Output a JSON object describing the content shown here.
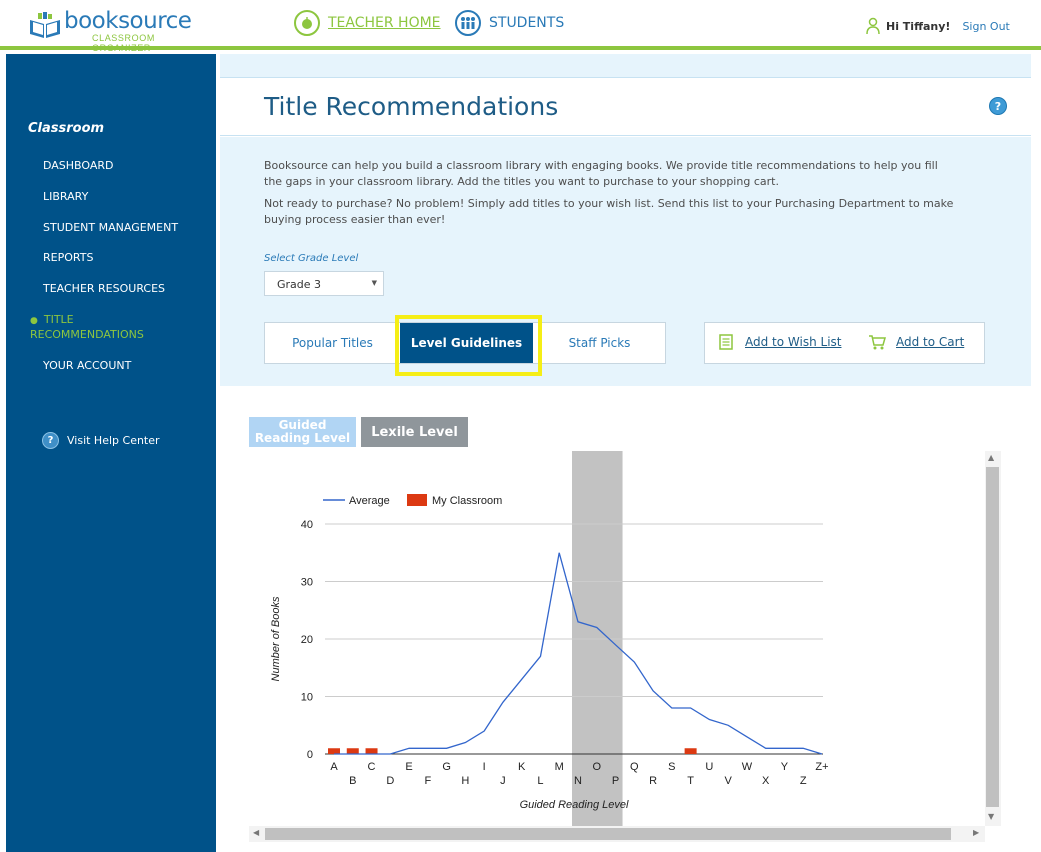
{
  "header": {
    "logo_name": "booksource",
    "logo_sub": "CLASSROOM ORGANIZER",
    "teacher_home": "TEACHER HOME",
    "students": "STUDENTS",
    "greeting": "Hi Tiffany!",
    "sign_out": "Sign Out"
  },
  "sidebar": {
    "title": "Classroom",
    "items": [
      {
        "label": "DASHBOARD"
      },
      {
        "label": "LIBRARY"
      },
      {
        "label": "STUDENT MANAGEMENT"
      },
      {
        "label": "REPORTS"
      },
      {
        "label": "TEACHER RESOURCES"
      },
      {
        "label": "TITLE"
      },
      {
        "label": "RECOMMENDATIONS"
      },
      {
        "label": "YOUR ACCOUNT"
      }
    ],
    "help": "Visit Help Center"
  },
  "main": {
    "title": "Title Recommendations",
    "help_glyph": "?",
    "intro1": "Booksource can help you build a classroom library with engaging books. We provide title recommendations to help you fill the gaps in your classroom library. Add the titles you want to purchase to your shopping cart.",
    "intro2": "Not ready to purchase? No problem! Simply add titles to your wish list. Send this list to your Purchasing Department to make buying process easier than ever!",
    "grade_label": "Select Grade Level",
    "grade_value": "Grade 3",
    "tabs": [
      {
        "label": "Popular Titles"
      },
      {
        "label": "Level Guidelines"
      },
      {
        "label": "Staff Picks"
      }
    ],
    "wish_list": "Add to Wish List",
    "cart": "Add to Cart",
    "toggle_grl": "Guided Reading Level",
    "toggle_lexile": "Lexile Level"
  },
  "colors": {
    "accent_green": "#8dc63f",
    "brand_blue": "#005289",
    "line_blue": "#3366cc",
    "bar_red": "#dc3912",
    "highlight_yellow": "#f5ee16"
  },
  "chart_data": {
    "type": "line",
    "xlabel": "Guided Reading Level",
    "ylabel": "Number of Books",
    "ylim": [
      0,
      40
    ],
    "yticks": [
      0,
      10,
      20,
      30,
      40
    ],
    "grid": true,
    "legend_position": "top-left",
    "categories": [
      "A",
      "B",
      "C",
      "D",
      "E",
      "F",
      "G",
      "H",
      "I",
      "J",
      "K",
      "L",
      "M",
      "N",
      "O",
      "P",
      "Q",
      "R",
      "S",
      "T",
      "U",
      "V",
      "W",
      "X",
      "Y",
      "Z",
      "Z+"
    ],
    "highlight_range": [
      "N",
      "P"
    ],
    "series": [
      {
        "name": "Average",
        "type": "line",
        "color": "#3366cc",
        "values": [
          0,
          0,
          0,
          0,
          1,
          1,
          1,
          2,
          4,
          9,
          13,
          17,
          35,
          23,
          22,
          19,
          16,
          11,
          8,
          8,
          6,
          5,
          3,
          1,
          1,
          1,
          0
        ]
      },
      {
        "name": "My Classroom",
        "type": "bar",
        "color": "#dc3912",
        "values": [
          1,
          1,
          1,
          0,
          0,
          0,
          0,
          0,
          0,
          0,
          0,
          0,
          0,
          0,
          0,
          0,
          0,
          0,
          0,
          1,
          0,
          0,
          0,
          0,
          0,
          0,
          0
        ]
      }
    ]
  }
}
